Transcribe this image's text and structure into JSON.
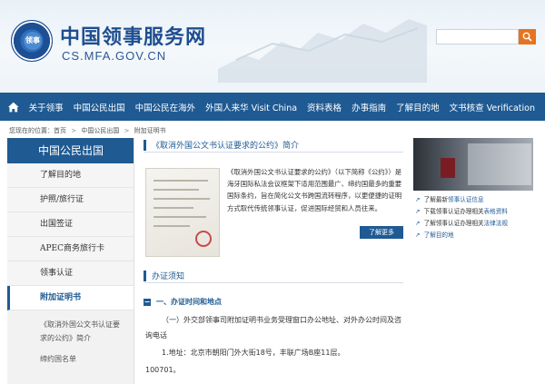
{
  "header": {
    "title": "中国领事服务网",
    "domain": "CS.MFA.GOV.CN",
    "seal_text": "领事"
  },
  "nav": {
    "items": [
      "关于领事",
      "中国公民出国",
      "中国公民在海外",
      "外国人来华 Visit China",
      "资料表格",
      "办事指南",
      "了解目的地",
      "文书核查 Verification"
    ]
  },
  "breadcrumb": {
    "prefix": "您现在的位置：首页",
    "items": [
      "中国公民出国",
      "附加证明书"
    ]
  },
  "sidebar": {
    "title": "中国公民出国",
    "items": [
      "了解目的地",
      "护照/旅行证",
      "出国签证",
      "APEC商务旅行卡",
      "领事认证",
      "附加证明书"
    ],
    "sub_item": "《取消外国公文书认证要求的公约》简介",
    "sub_item2": "缔约国名单"
  },
  "main": {
    "section1_title": "《取消外国公文书认证要求的公约》简介",
    "intro": "《取消外国公文书认证要求的公约》（以下简称《公约》）是海牙国际私法会议框架下适用范围最广、缔约国最多的重要国际条约，旨在简化公文书跨国流转程序，以更便捷的证明方式取代传统领事认证，促进国际经贸和人员往来。",
    "more_label": "了解更多",
    "section2_title": "办证须知",
    "sub_head": "一、办证时间和地点",
    "para1": "（一）外交部领事司附加证明书业务受理窗口办公地址、对外办公时间及咨询电话",
    "para2": "1.地址：北京市朝阳门外大街18号，丰联广场B座11层。",
    "para3": "100701。"
  },
  "right": {
    "links": [
      {
        "prefix": "了解最新",
        "link": "领事认证信息"
      },
      {
        "prefix": "下载领事认证办理相关",
        "link": "表格资料"
      },
      {
        "prefix": "了解领事认证办理相关",
        "link": "法律法规"
      },
      {
        "prefix": "",
        "link": "了解目的地"
      }
    ]
  }
}
